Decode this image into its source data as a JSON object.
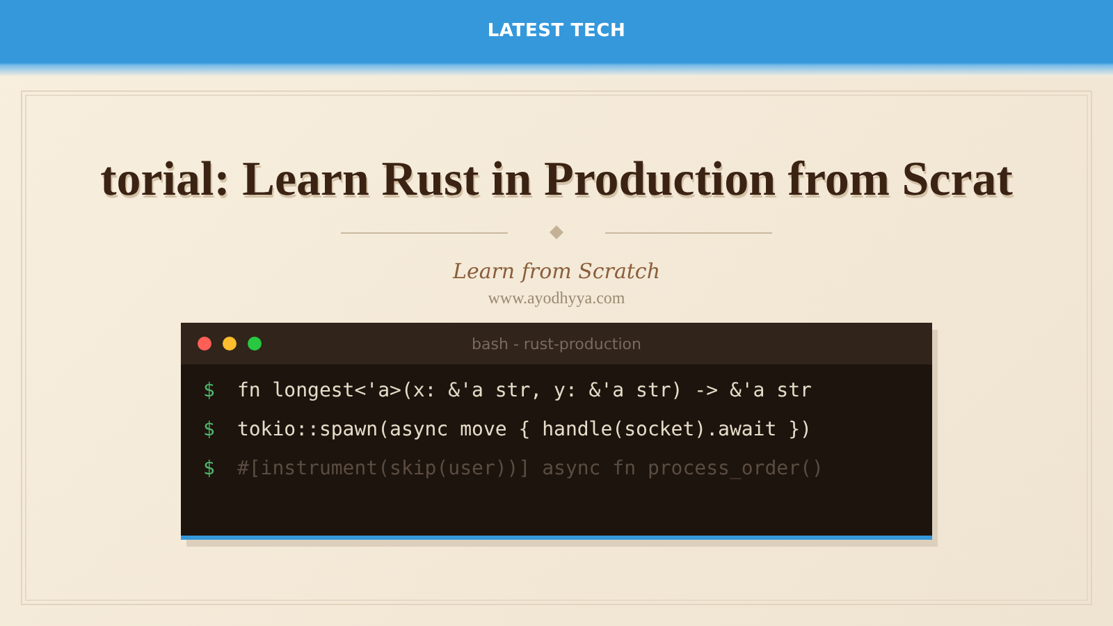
{
  "header": {
    "title": "LATEST TECH"
  },
  "hero": {
    "title": "torial: Learn Rust in Production from Scrat",
    "subtitle": "Learn from Scratch",
    "website": "www.ayodhyya.com"
  },
  "terminal": {
    "title": "bash - rust-production",
    "lines": [
      {
        "prompt": "$",
        "command": "fn longest<'a>(x: &'a str, y: &'a str) -> &'a str",
        "dimmed": false
      },
      {
        "prompt": "$",
        "command": "tokio::spawn(async move { handle(socket).await })",
        "dimmed": false
      },
      {
        "prompt": "$",
        "command": "#[instrument(skip(user))] async fn process_order()",
        "dimmed": true
      }
    ]
  }
}
